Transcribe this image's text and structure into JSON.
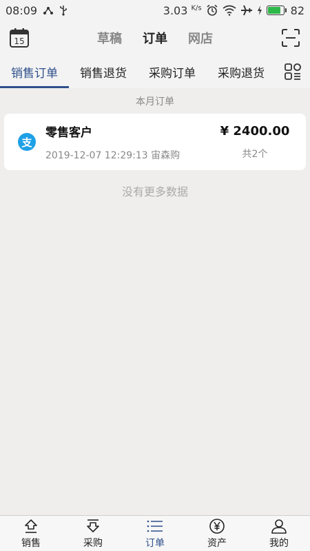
{
  "status": {
    "time": "08:09",
    "net_speed": "3.03",
    "net_unit": "K/s",
    "battery": "82",
    "battery_level": 0.82
  },
  "header": {
    "calendar_day": "15",
    "tabs": [
      {
        "label": "草稿"
      },
      {
        "label": "订单"
      },
      {
        "label": "网店"
      }
    ]
  },
  "categories": [
    {
      "label": "销售订单"
    },
    {
      "label": "销售退货"
    },
    {
      "label": "采购订单"
    },
    {
      "label": "采购退货"
    }
  ],
  "section_title": "本月订单",
  "orders": [
    {
      "pay_icon_glyph": "支",
      "customer": "零售客户",
      "datetime_user": "2019-12-07 12:29:13 宙森购",
      "amount": "¥ 2400.00",
      "count": "共2个"
    }
  ],
  "no_more_text": "没有更多数据",
  "bottom_nav": [
    {
      "label": "销售",
      "icon": "upload-icon"
    },
    {
      "label": "采购",
      "icon": "download-icon"
    },
    {
      "label": "订单",
      "icon": "list-icon"
    },
    {
      "label": "资产",
      "icon": "yuan-circle-icon"
    },
    {
      "label": "我的",
      "icon": "person-icon"
    }
  ],
  "colors": {
    "accent": "#2e4f8c",
    "alipay_blue": "#1ea0e6",
    "battery_green": "#2fb84a"
  }
}
